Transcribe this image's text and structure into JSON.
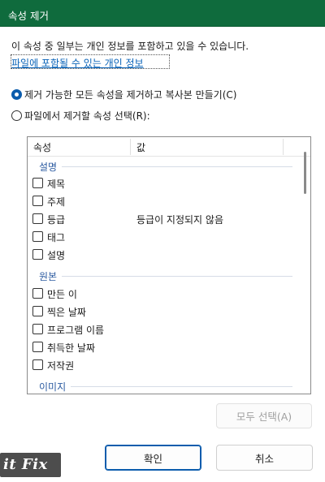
{
  "window": {
    "title": "속성 제거"
  },
  "intro_text": "이 속성 중 일부는 개인 정보를 포함하고 있을 수 있습니다.",
  "link_text": "파일에 포함될 수 있는 개인 정보",
  "options": [
    {
      "label": "제거 가능한 모든 속성을 제거하고 복사본 만들기(C)",
      "selected": true
    },
    {
      "label": "파일에서 제거할 속성 선택(R):",
      "selected": false
    }
  ],
  "list": {
    "columns": [
      "속성",
      "값"
    ],
    "groups": [
      {
        "name": "설명",
        "items": [
          {
            "name": "제목",
            "value": ""
          },
          {
            "name": "주제",
            "value": ""
          },
          {
            "name": "등급",
            "value": "등급이 지정되지 않음"
          },
          {
            "name": "태그",
            "value": ""
          },
          {
            "name": "설명",
            "value": ""
          }
        ]
      },
      {
        "name": "원본",
        "items": [
          {
            "name": "만든 이",
            "value": ""
          },
          {
            "name": "찍은 날짜",
            "value": ""
          },
          {
            "name": "프로그램 이름",
            "value": ""
          },
          {
            "name": "취득한 날짜",
            "value": ""
          },
          {
            "name": "저작권",
            "value": ""
          }
        ]
      },
      {
        "name": "이미지",
        "items": []
      }
    ]
  },
  "buttons": {
    "select_all": "모두 선택(A)",
    "ok": "확인",
    "cancel": "취소"
  },
  "watermark": "it Fix",
  "colors": {
    "titlebar": "#0f6b3d",
    "accent": "#0b5cad",
    "link": "#0a63b8",
    "group_label": "#2b5aa0"
  }
}
